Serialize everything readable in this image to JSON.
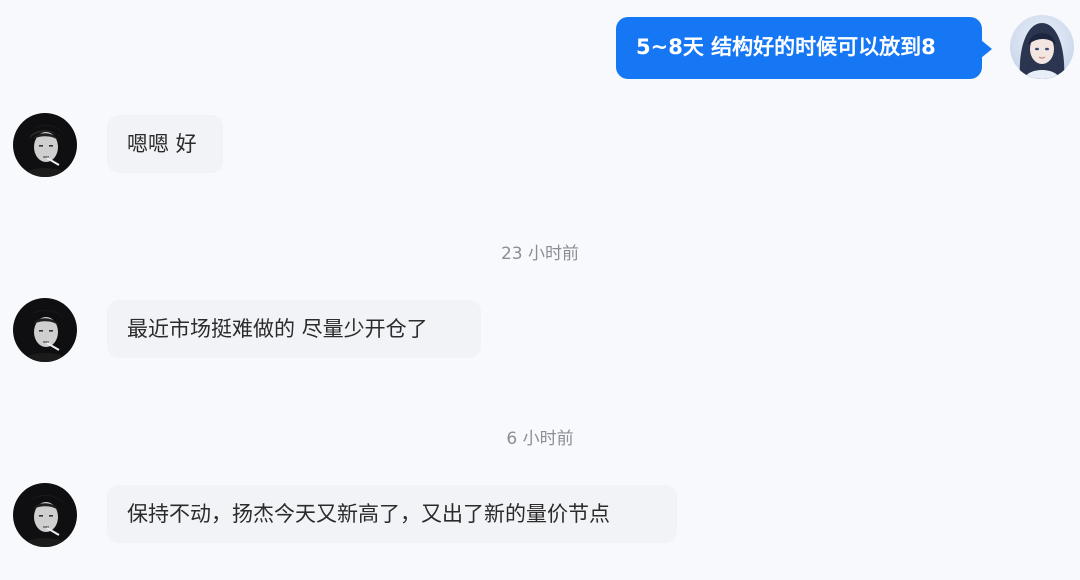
{
  "conversation": {
    "messages": [
      {
        "direction": "outgoing",
        "text": "5~8天  结构好的时候可以放到8"
      },
      {
        "direction": "incoming",
        "text": "嗯嗯 好"
      },
      {
        "direction": "incoming",
        "text": "最近市场挺难做的  尽量少开仓了"
      },
      {
        "direction": "incoming",
        "text": "保持不动，扬杰今天又新高了，又出了新的量价节点"
      }
    ],
    "timestamps": [
      "23 小时前",
      "6 小时前"
    ]
  },
  "colors": {
    "outgoing_bubble": "#1677f5",
    "incoming_bubble": "#f2f3f7",
    "background": "#f8f9fc",
    "timestamp_text": "#8b8e96"
  }
}
